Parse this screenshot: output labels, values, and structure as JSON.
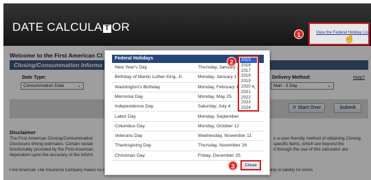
{
  "header": {
    "logo_part1": "DATE CALCULA",
    "logo_mark": "T",
    "logo_part2": "OR",
    "federal_link": "View the Federal Holiday List"
  },
  "page": {
    "welcome": "Welcome to the First American Cl",
    "section_title": "Closing/Consummation Informa",
    "date_type_label": "Date Type:",
    "date_type_value": "Consummation Date",
    "delivery_label": "Delivery Method:",
    "delivery_value": "Mail - 3 Day",
    "help_label": "Help?",
    "start_over": "Start Over",
    "submit": "Submit",
    "disclaimer_title": "Disclaimer",
    "disclaimer_lines": [
      "The First American Closing/Consummation",
      "Disclosure timing estimates. Certain variab",
      "functionality provided by the First American",
      "dependent upon the accuracy of the inform"
    ],
    "disclaimer_right": [
      "n a user-friendly method of obtaining Closing",
      "specific items, which are beyond the",
      "d through the use of this calculator are"
    ],
    "footer_line": "First American Title Insurance Company makes no express or implied warranty regarding the information presented and disclaims no responsibility or liability for errors"
  },
  "badges": [
    "1",
    "2",
    "3"
  ],
  "modal": {
    "header": "Federal Holidays",
    "holidays": [
      {
        "name": "New Year's Day",
        "date": "Thursday, January 1"
      },
      {
        "name": "Birthday of Martin Luther King, Jr.",
        "date": "Monday, January 1"
      },
      {
        "name": "Washington's Birthday",
        "date": "Monday, February 1"
      },
      {
        "name": "Memorial Day",
        "date": "Monday, May 25"
      },
      {
        "name": "Independence Day",
        "date": "Saturday, July 4"
      },
      {
        "name": "Labor Day",
        "date": "Monday, September"
      },
      {
        "name": "Columbus Day",
        "date": "Monday, October 12"
      },
      {
        "name": "Veterans Day",
        "date": "Wednesday, November 11"
      },
      {
        "name": "Thanksgiving Day",
        "date": "Thursday, November 26"
      },
      {
        "name": "Christmas Day",
        "date": "Friday, December 25"
      }
    ],
    "years": [
      "2015",
      "2016",
      "2017",
      "2018",
      "2019",
      "2020",
      "2021",
      "2022",
      "2023",
      "2024"
    ],
    "selected_year": "2015",
    "close_label": "Close"
  },
  "colors": {
    "header_bg": "#151515",
    "section_bar": "#3f5a7c",
    "modal_header": "#24467a",
    "highlight_red": "#d01c1c",
    "year_selected": "#2a62c9"
  },
  "icons": [
    "cursor-hand-icon",
    "refresh-icon",
    "mouse-pointer-icon"
  ]
}
